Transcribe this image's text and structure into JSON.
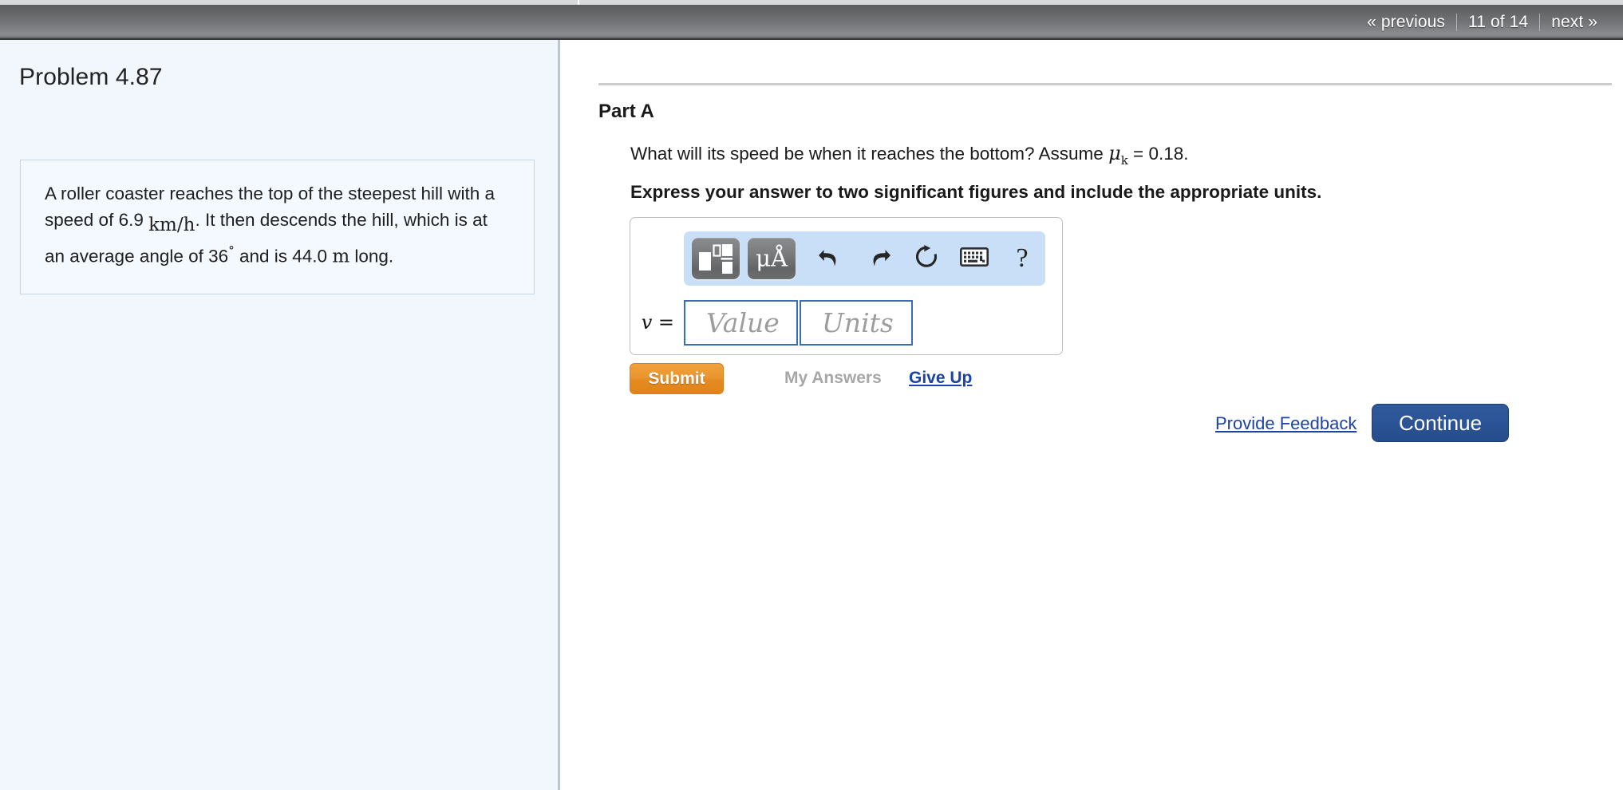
{
  "nav": {
    "previous_label": "« previous",
    "position_label": "11 of 14",
    "next_label": "next »"
  },
  "problem": {
    "title": "Problem 4.87",
    "statement_part1": "A roller coaster reaches the top of the steepest hill with a speed of 6.9",
    "statement_unit_speed": "km/h",
    "statement_part2": ". It then descends the hill, which is at an average angle of 36",
    "statement_degree": "°",
    "statement_part3": "and is 44.0",
    "statement_unit_length": "m",
    "statement_part4": "long."
  },
  "part": {
    "label": "Part A",
    "question_text": "What will its speed be when it reaches the bottom? Assume",
    "question_symbol": "μ",
    "question_subscript": "k",
    "question_value": "= 0.18.",
    "instruction": "Express your answer to two significant figures and include the appropriate units."
  },
  "answer": {
    "variable_label": "v =",
    "value_placeholder": "Value",
    "units_placeholder": "Units",
    "value_current": "",
    "units_current": "",
    "toolbar": {
      "template_icon": "math-template-icon",
      "units_icon": "micro-angstrom-units-icon",
      "units_text": "μÅ",
      "undo_icon": "undo-arrow-icon",
      "redo_icon": "redo-arrow-icon",
      "reset_icon": "reset-circular-arrow-icon",
      "keyboard_icon": "keyboard-icon",
      "help_icon": "?"
    }
  },
  "actions": {
    "submit_label": "Submit",
    "my_answers_label": "My Answers",
    "give_up_label": "Give Up",
    "provide_feedback_label": "Provide Feedback",
    "continue_label": "Continue"
  },
  "colors": {
    "submit_orange": "#e58a22",
    "continue_blue": "#2b5496",
    "link_blue": "#1b42a5",
    "toolbar_blue": "#c9dff8",
    "panel_blue": "#f2f7fd"
  }
}
